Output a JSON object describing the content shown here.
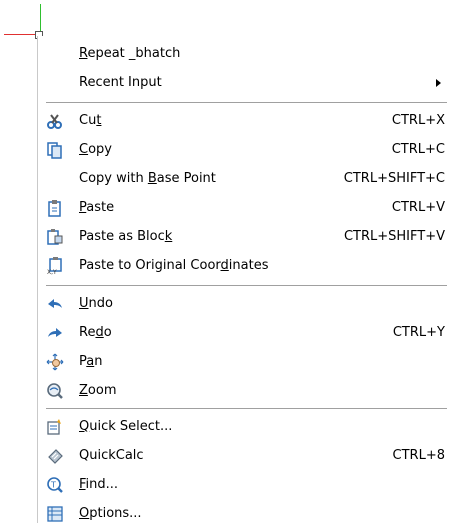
{
  "menu": {
    "repeat": {
      "label": "Repeat _bhatch",
      "mnemonic": "R"
    },
    "recent_input": {
      "label": "Recent Input"
    },
    "cut": {
      "label": "Cut",
      "mnemonic": "t",
      "shortcut": "CTRL+X",
      "icon": "scissors-icon"
    },
    "copy": {
      "label": "Copy",
      "mnemonic": "C",
      "shortcut": "CTRL+C",
      "icon": "copy-icon"
    },
    "copy_base": {
      "label": "Copy with Base Point",
      "mnemonic": "B",
      "shortcut": "CTRL+SHIFT+C"
    },
    "paste": {
      "label": "Paste",
      "mnemonic": "P",
      "shortcut": "CTRL+V",
      "icon": "clipboard-icon"
    },
    "paste_block": {
      "label": "Paste as Block",
      "mnemonic": "k",
      "shortcut": "CTRL+SHIFT+V",
      "icon": "paste-block-icon"
    },
    "paste_orig": {
      "label": "Paste to Original Coordinates",
      "mnemonic": "d",
      "icon": "paste-coordinates-icon"
    },
    "undo": {
      "label": "Undo",
      "mnemonic": "U",
      "icon": "undo-arrow-icon"
    },
    "redo": {
      "label": "Redo",
      "mnemonic": "d",
      "shortcut": "CTRL+Y",
      "icon": "redo-arrow-icon"
    },
    "pan": {
      "label": "Pan",
      "mnemonic": "a",
      "icon": "pan-hand-icon"
    },
    "zoom": {
      "label": "Zoom",
      "mnemonic": "Z",
      "icon": "zoom-magnifier-icon"
    },
    "quick_select": {
      "label": "Quick Select...",
      "mnemonic": "Q",
      "icon": "quick-select-icon"
    },
    "quickcalc": {
      "label": "QuickCalc",
      "shortcut": "CTRL+8",
      "icon": "calculator-icon"
    },
    "find": {
      "label": "Find...",
      "mnemonic": "F",
      "icon": "find-icon"
    },
    "options": {
      "label": "Options...",
      "mnemonic": "O",
      "icon": "options-icon"
    }
  },
  "colors": {
    "icon_blue": "#2f6fb7",
    "icon_gray": "#7a7a7a",
    "separator": "#a0a0a0"
  }
}
